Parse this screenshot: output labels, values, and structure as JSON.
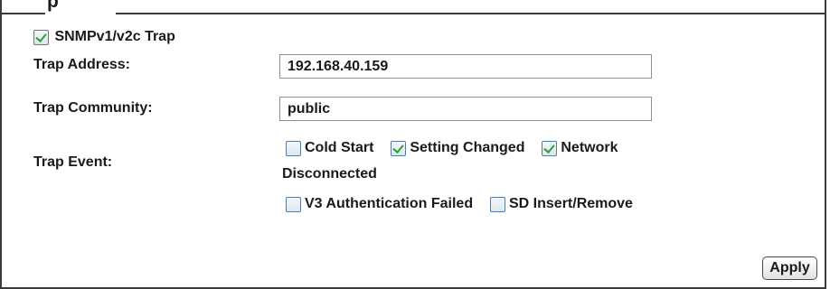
{
  "section": {
    "title_fragment": "p"
  },
  "snmp_trap": {
    "label": "SNMPv1/v2c Trap",
    "checked": true
  },
  "trap_address": {
    "label": "Trap Address:",
    "value": "192.168.40.159"
  },
  "trap_community": {
    "label": "Trap Community:",
    "value": "public"
  },
  "trap_event": {
    "label": "Trap Event:",
    "options": [
      {
        "label": "Cold Start",
        "checked": false
      },
      {
        "label": "Setting Changed",
        "checked": true
      },
      {
        "label": "Network",
        "checked": true
      },
      {
        "label": "Disconnected"
      },
      {
        "label": "V3 Authentication Failed",
        "checked": false
      },
      {
        "label": "SD Insert/Remove",
        "checked": false
      }
    ]
  },
  "actions": {
    "apply_label": "Apply"
  },
  "colors": {
    "checkmark": "#2aa03a",
    "border": "#3a3a3a"
  }
}
